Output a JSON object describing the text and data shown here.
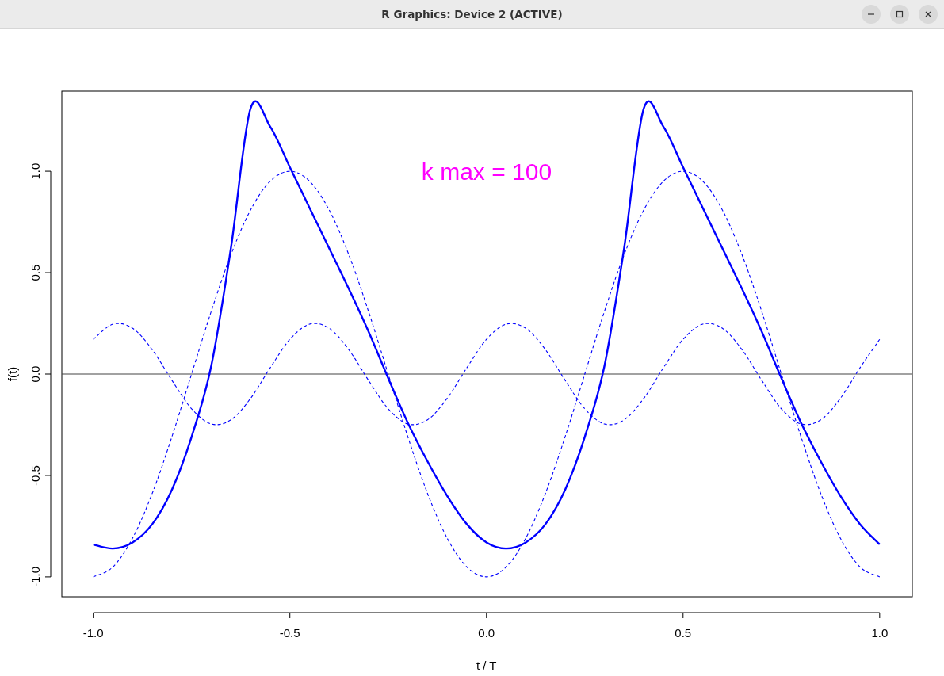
{
  "window": {
    "title": "R Graphics: Device 2 (ACTIVE)"
  },
  "plot": {
    "chart_data": {
      "type": "line",
      "xlabel": "t / T",
      "ylabel": "f(t)",
      "xlim": [
        -1.08,
        1.083
      ],
      "ylim": [
        -1.098,
        1.395
      ],
      "xticks": [
        {
          "value": -1,
          "label": "-1.0"
        },
        {
          "value": -0.5,
          "label": "-0.5"
        },
        {
          "value": 0,
          "label": "0.0"
        },
        {
          "value": 0.5,
          "label": "0.5"
        },
        {
          "value": 1,
          "label": "1.0"
        }
      ],
      "yticks": [
        {
          "value": -1,
          "label": "-1.0"
        },
        {
          "value": -0.5,
          "label": "-0.5"
        },
        {
          "value": 0,
          "label": "0.0"
        },
        {
          "value": 0.5,
          "label": "0.5"
        },
        {
          "value": 1,
          "label": "1.0"
        }
      ],
      "x": [
        -1,
        -0.95,
        -0.9,
        -0.85,
        -0.8,
        -0.75,
        -0.7,
        -0.65,
        -0.6,
        -0.55,
        -0.5,
        -0.45,
        -0.4,
        -0.35,
        -0.3,
        -0.25,
        -0.2,
        -0.15,
        -0.1,
        -0.05,
        0,
        0.05,
        0.1,
        0.15,
        0.2,
        0.25,
        0.3,
        0.35,
        0.4,
        0.45,
        0.5,
        0.55,
        0.6,
        0.65,
        0.7,
        0.75,
        0.8,
        0.85,
        0.9,
        0.95,
        1
      ],
      "series": [
        {
          "line_style": "solid",
          "color": "#0000ff",
          "values": [
            -0.84,
            -0.86,
            -0.83,
            -0.74,
            -0.57,
            -0.31,
            0.04,
            0.62,
            1.31,
            1.22,
            1.02,
            0.82,
            0.62,
            0.42,
            0.21,
            -0.02,
            -0.24,
            -0.43,
            -0.6,
            -0.74,
            -0.83,
            -0.86,
            -0.83,
            -0.74,
            -0.57,
            -0.31,
            0.04,
            0.62,
            1.31,
            1.22,
            1.02,
            0.82,
            0.62,
            0.42,
            0.21,
            -0.02,
            -0.24,
            -0.43,
            -0.6,
            -0.74,
            -0.84
          ]
        },
        {
          "line_style": "dashed",
          "color": "#0000ff",
          "values": [
            -1,
            -0.951,
            -0.809,
            -0.588,
            -0.309,
            0,
            0.309,
            0.588,
            0.809,
            0.951,
            1,
            0.951,
            0.809,
            0.588,
            0.309,
            0,
            -0.309,
            -0.588,
            -0.809,
            -0.951,
            -1,
            -0.951,
            -0.809,
            -0.588,
            -0.309,
            0,
            0.309,
            0.588,
            0.809,
            0.951,
            1,
            0.951,
            0.809,
            0.588,
            0.309,
            0,
            -0.309,
            -0.588,
            -0.809,
            -0.951,
            -1
          ]
        },
        {
          "line_style": "dashed",
          "color": "#0000ff",
          "values": [
            0.171,
            0.246,
            0.226,
            0.12,
            -0.031,
            -0.171,
            -0.246,
            -0.226,
            -0.12,
            0.031,
            0.171,
            0.246,
            0.226,
            0.12,
            -0.031,
            -0.171,
            -0.246,
            -0.226,
            -0.12,
            0.031,
            0.171,
            0.246,
            0.226,
            0.12,
            -0.031,
            -0.171,
            -0.246,
            -0.226,
            -0.12,
            0.031,
            0.171,
            0.246,
            0.226,
            0.12,
            -0.031,
            -0.171,
            -0.246,
            -0.226,
            -0.12,
            0.031,
            0.171
          ]
        }
      ],
      "annotations": [
        "k max = 100"
      ]
    }
  }
}
